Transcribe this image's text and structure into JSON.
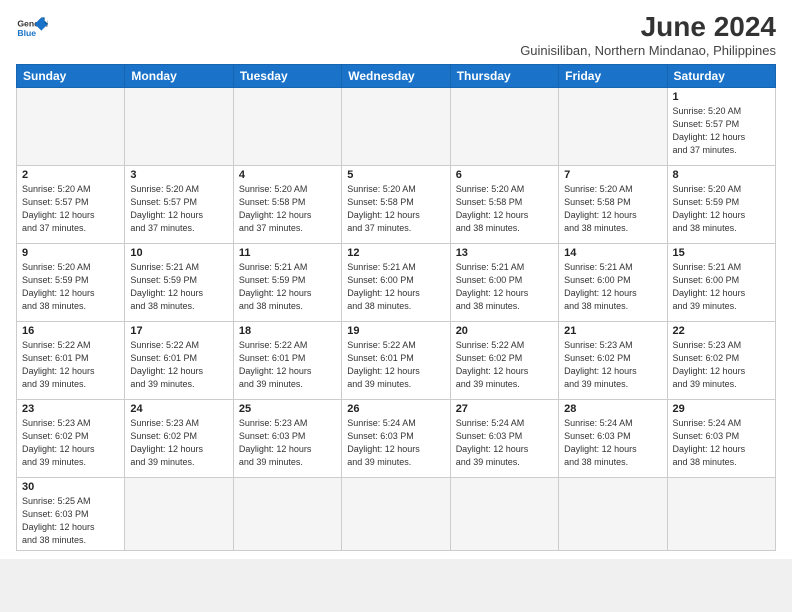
{
  "header": {
    "logo_general": "General",
    "logo_blue": "Blue",
    "month_title": "June 2024",
    "location": "Guinisiliban, Northern Mindanao, Philippines"
  },
  "days_of_week": [
    "Sunday",
    "Monday",
    "Tuesday",
    "Wednesday",
    "Thursday",
    "Friday",
    "Saturday"
  ],
  "weeks": [
    [
      {
        "day": "",
        "info": ""
      },
      {
        "day": "",
        "info": ""
      },
      {
        "day": "",
        "info": ""
      },
      {
        "day": "",
        "info": ""
      },
      {
        "day": "",
        "info": ""
      },
      {
        "day": "",
        "info": ""
      },
      {
        "day": "1",
        "info": "Sunrise: 5:20 AM\nSunset: 5:57 PM\nDaylight: 12 hours\nand 37 minutes."
      }
    ],
    [
      {
        "day": "2",
        "info": "Sunrise: 5:20 AM\nSunset: 5:57 PM\nDaylight: 12 hours\nand 37 minutes."
      },
      {
        "day": "3",
        "info": "Sunrise: 5:20 AM\nSunset: 5:57 PM\nDaylight: 12 hours\nand 37 minutes."
      },
      {
        "day": "4",
        "info": "Sunrise: 5:20 AM\nSunset: 5:58 PM\nDaylight: 12 hours\nand 37 minutes."
      },
      {
        "day": "5",
        "info": "Sunrise: 5:20 AM\nSunset: 5:58 PM\nDaylight: 12 hours\nand 37 minutes."
      },
      {
        "day": "6",
        "info": "Sunrise: 5:20 AM\nSunset: 5:58 PM\nDaylight: 12 hours\nand 38 minutes."
      },
      {
        "day": "7",
        "info": "Sunrise: 5:20 AM\nSunset: 5:58 PM\nDaylight: 12 hours\nand 38 minutes."
      },
      {
        "day": "8",
        "info": "Sunrise: 5:20 AM\nSunset: 5:59 PM\nDaylight: 12 hours\nand 38 minutes."
      }
    ],
    [
      {
        "day": "9",
        "info": "Sunrise: 5:20 AM\nSunset: 5:59 PM\nDaylight: 12 hours\nand 38 minutes."
      },
      {
        "day": "10",
        "info": "Sunrise: 5:21 AM\nSunset: 5:59 PM\nDaylight: 12 hours\nand 38 minutes."
      },
      {
        "day": "11",
        "info": "Sunrise: 5:21 AM\nSunset: 5:59 PM\nDaylight: 12 hours\nand 38 minutes."
      },
      {
        "day": "12",
        "info": "Sunrise: 5:21 AM\nSunset: 6:00 PM\nDaylight: 12 hours\nand 38 minutes."
      },
      {
        "day": "13",
        "info": "Sunrise: 5:21 AM\nSunset: 6:00 PM\nDaylight: 12 hours\nand 38 minutes."
      },
      {
        "day": "14",
        "info": "Sunrise: 5:21 AM\nSunset: 6:00 PM\nDaylight: 12 hours\nand 38 minutes."
      },
      {
        "day": "15",
        "info": "Sunrise: 5:21 AM\nSunset: 6:00 PM\nDaylight: 12 hours\nand 39 minutes."
      }
    ],
    [
      {
        "day": "16",
        "info": "Sunrise: 5:22 AM\nSunset: 6:01 PM\nDaylight: 12 hours\nand 39 minutes."
      },
      {
        "day": "17",
        "info": "Sunrise: 5:22 AM\nSunset: 6:01 PM\nDaylight: 12 hours\nand 39 minutes."
      },
      {
        "day": "18",
        "info": "Sunrise: 5:22 AM\nSunset: 6:01 PM\nDaylight: 12 hours\nand 39 minutes."
      },
      {
        "day": "19",
        "info": "Sunrise: 5:22 AM\nSunset: 6:01 PM\nDaylight: 12 hours\nand 39 minutes."
      },
      {
        "day": "20",
        "info": "Sunrise: 5:22 AM\nSunset: 6:02 PM\nDaylight: 12 hours\nand 39 minutes."
      },
      {
        "day": "21",
        "info": "Sunrise: 5:23 AM\nSunset: 6:02 PM\nDaylight: 12 hours\nand 39 minutes."
      },
      {
        "day": "22",
        "info": "Sunrise: 5:23 AM\nSunset: 6:02 PM\nDaylight: 12 hours\nand 39 minutes."
      }
    ],
    [
      {
        "day": "23",
        "info": "Sunrise: 5:23 AM\nSunset: 6:02 PM\nDaylight: 12 hours\nand 39 minutes."
      },
      {
        "day": "24",
        "info": "Sunrise: 5:23 AM\nSunset: 6:02 PM\nDaylight: 12 hours\nand 39 minutes."
      },
      {
        "day": "25",
        "info": "Sunrise: 5:23 AM\nSunset: 6:03 PM\nDaylight: 12 hours\nand 39 minutes."
      },
      {
        "day": "26",
        "info": "Sunrise: 5:24 AM\nSunset: 6:03 PM\nDaylight: 12 hours\nand 39 minutes."
      },
      {
        "day": "27",
        "info": "Sunrise: 5:24 AM\nSunset: 6:03 PM\nDaylight: 12 hours\nand 39 minutes."
      },
      {
        "day": "28",
        "info": "Sunrise: 5:24 AM\nSunset: 6:03 PM\nDaylight: 12 hours\nand 38 minutes."
      },
      {
        "day": "29",
        "info": "Sunrise: 5:24 AM\nSunset: 6:03 PM\nDaylight: 12 hours\nand 38 minutes."
      }
    ],
    [
      {
        "day": "30",
        "info": "Sunrise: 5:25 AM\nSunset: 6:03 PM\nDaylight: 12 hours\nand 38 minutes."
      },
      {
        "day": "",
        "info": ""
      },
      {
        "day": "",
        "info": ""
      },
      {
        "day": "",
        "info": ""
      },
      {
        "day": "",
        "info": ""
      },
      {
        "day": "",
        "info": ""
      },
      {
        "day": "",
        "info": ""
      }
    ]
  ]
}
